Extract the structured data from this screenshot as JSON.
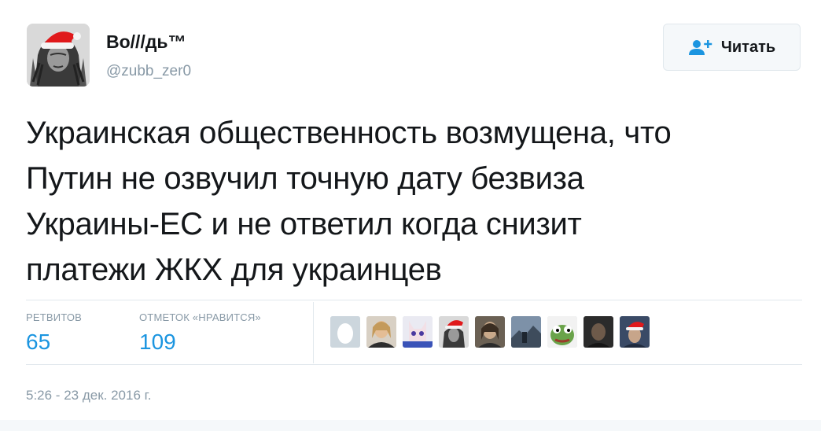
{
  "user": {
    "name": "Во///дь™",
    "handle": "@zubb_zer0"
  },
  "follow_button": {
    "label": "Читать",
    "icon": "add-user-icon"
  },
  "tweet": {
    "lines": [
      "Украинская общественность возмущена, что",
      "Путин не озвучил точную дату безвиза",
      "Украины-ЕС и не ответил когда снизит",
      "платежи ЖКХ для украинцев"
    ]
  },
  "stats": {
    "retweets_label": "РЕТВИТОВ",
    "retweets_value": "65",
    "likes_label": "ОТМЕТОК «НРАВИТСЯ»",
    "likes_value": "109"
  },
  "liker_avatars": [
    "default-egg-avatar",
    "woman-avatar",
    "cat-face-avatar",
    "santa-hat-chief-avatar",
    "woman-portrait-avatar",
    "landscape-avatar",
    "pepe-frog-avatar",
    "dark-portrait-avatar",
    "santa-hat-portrait-avatar"
  ],
  "timestamp": "5:26 - 23 дек. 2016 г.",
  "colors": {
    "accent": "#1b95e0",
    "muted": "#8899a6",
    "text": "#14171a"
  }
}
